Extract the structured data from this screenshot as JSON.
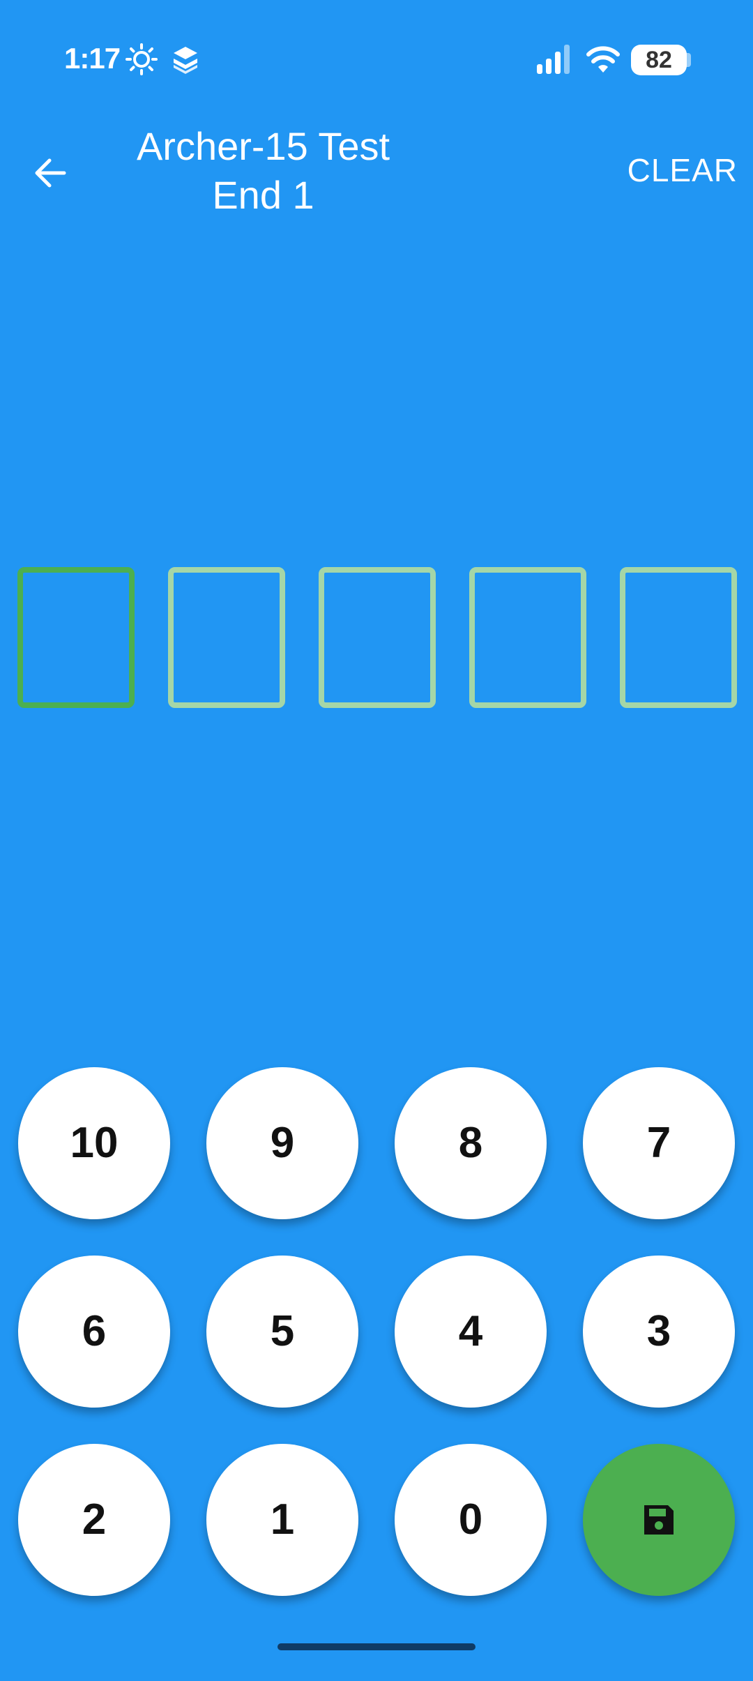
{
  "status_bar": {
    "time": "1:17",
    "battery": "82",
    "icons": [
      "brightness-icon",
      "layers-app-icon",
      "signal-icon",
      "wifi-icon",
      "battery-icon"
    ]
  },
  "app_bar": {
    "back_icon": "arrow-left-icon",
    "title_line1": "Archer-15 Test",
    "title_line2": "End 1",
    "clear_label": "CLEAR"
  },
  "score_boxes": {
    "count": 5,
    "active_index": 0,
    "values": [
      "",
      "",
      "",
      "",
      ""
    ]
  },
  "keypad": {
    "keys": [
      "10",
      "9",
      "8",
      "7",
      "6",
      "5",
      "4",
      "3",
      "2",
      "1",
      "0"
    ],
    "save_icon": "save-icon"
  },
  "colors": {
    "background": "#2196F3",
    "active_box": "#4CAF50",
    "inactive_box": "#A5D6A7",
    "save_button": "#4CAF50",
    "key": "#FFFFFF"
  }
}
